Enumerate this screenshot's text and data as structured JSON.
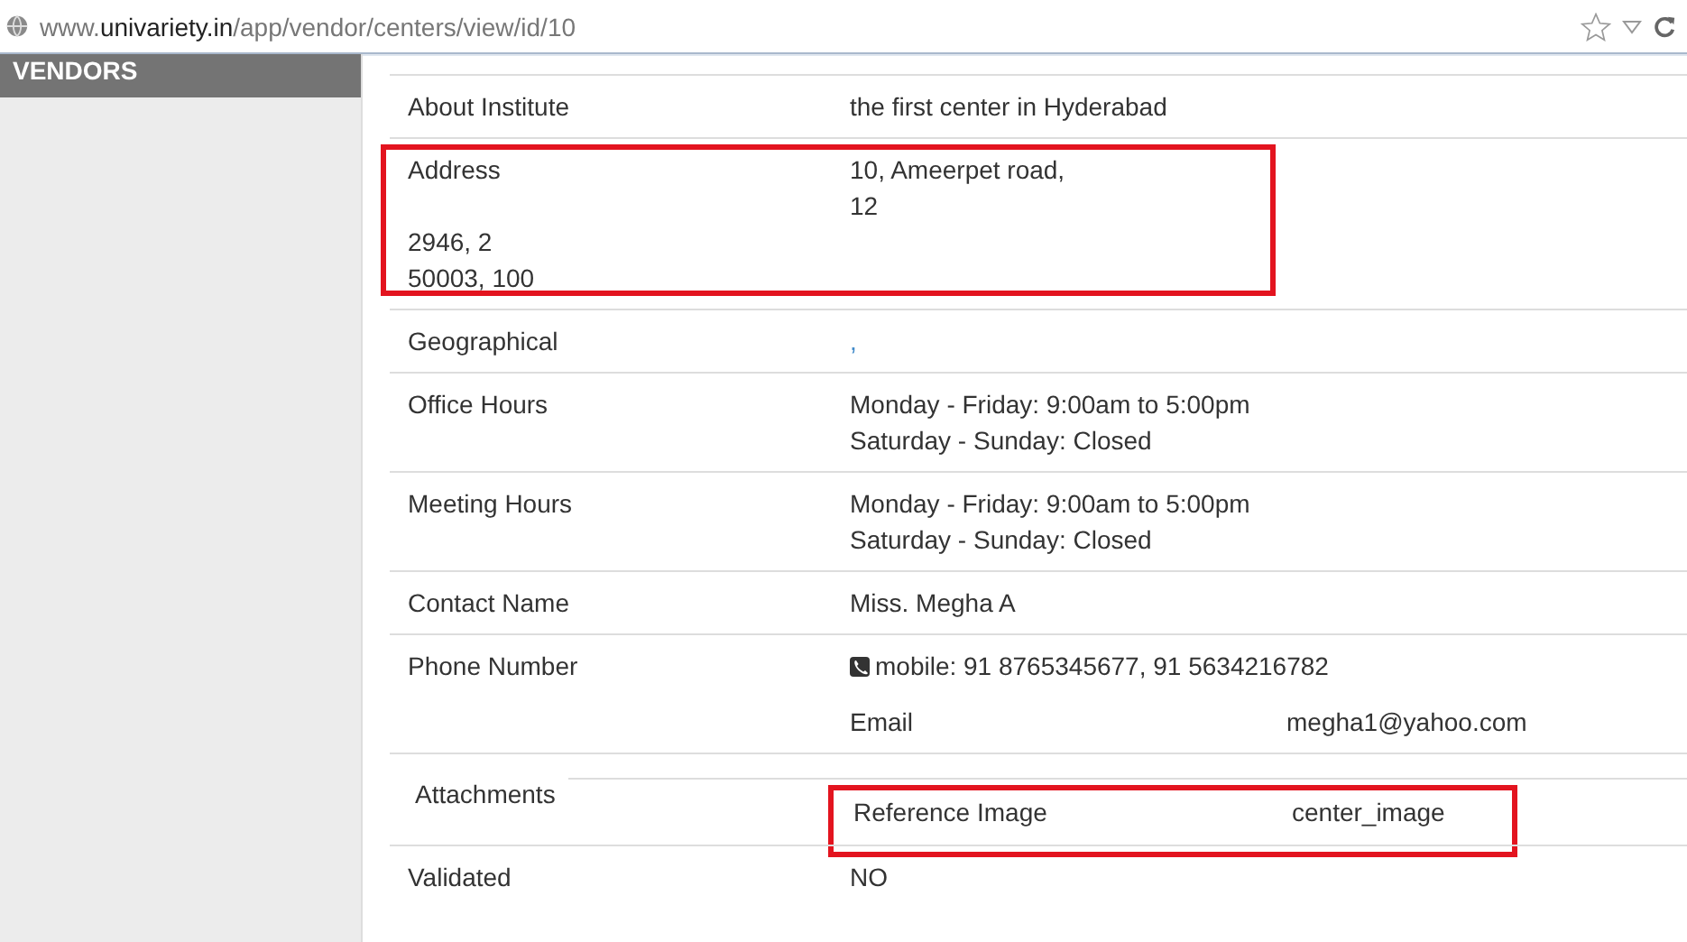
{
  "address_bar": {
    "url": "www.**univariety.in**/app/vendor/centers/view/id/10"
  },
  "sidebar": {
    "heading": "VENDORS"
  },
  "details": [
    {
      "kind": "text",
      "label": "About Institute",
      "lines": [
        "the first center in Hyderabad"
      ],
      "highlighted": false
    },
    {
      "kind": "text",
      "label": "Address",
      "lines": [
        "10, Ameerpet road,",
        "12"
      ],
      "extra_lines": [
        "2946, 2",
        "50003, 100"
      ],
      "highlighted": true
    },
    {
      "kind": "link",
      "label": "Geographical",
      "lines": [
        ","
      ],
      "highlighted": false
    },
    {
      "kind": "text",
      "label": "Office Hours",
      "lines": [
        "Monday - Friday: 9:00am to 5:00pm",
        "Saturday - Sunday: Closed"
      ],
      "highlighted": false
    },
    {
      "kind": "text",
      "label": "Meeting Hours",
      "lines": [
        "Monday - Friday: 9:00am to 5:00pm",
        "Saturday - Sunday: Closed"
      ],
      "highlighted": false
    },
    {
      "kind": "text",
      "label": "Contact Name",
      "lines": [
        "Miss. Megha A"
      ],
      "highlighted": false
    },
    {
      "kind": "phone",
      "label": "Phone Number",
      "lines": [
        "mobile: 91 8765345677, 91 5634216782"
      ],
      "sub": {
        "label": "Email",
        "value": "megha1@yahoo.com"
      },
      "highlighted": false
    },
    {
      "kind": "attachments",
      "label": "Attachments",
      "sub": {
        "label": "Reference Image",
        "value": "center_image"
      },
      "highlighted": true
    },
    {
      "kind": "text",
      "label": "Validated",
      "lines": [
        "NO"
      ],
      "highlighted": false
    }
  ]
}
